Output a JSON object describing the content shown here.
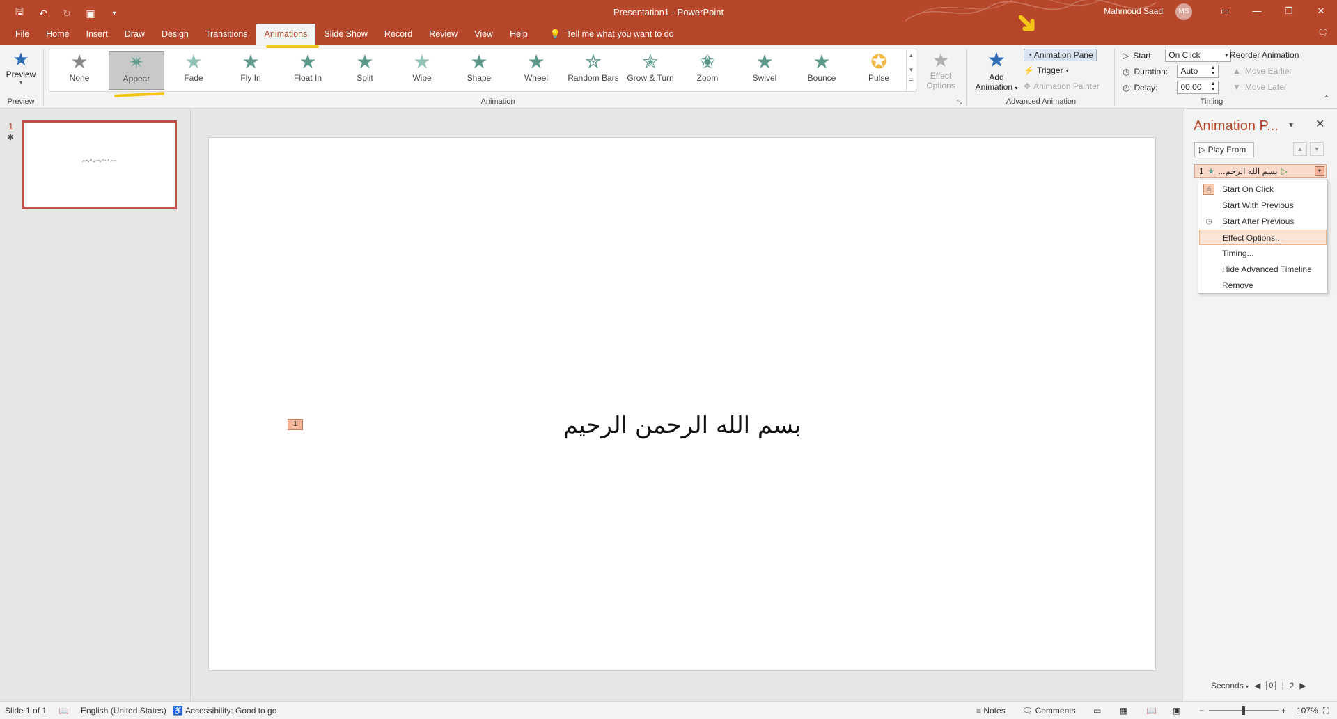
{
  "titlebar": {
    "doc_title": "Presentation1  -  PowerPoint",
    "user_name": "Mahmoud Saad",
    "user_initials": "MS"
  },
  "tabs": [
    "File",
    "Home",
    "Insert",
    "Draw",
    "Design",
    "Transitions",
    "Animations",
    "Slide Show",
    "Record",
    "Review",
    "View",
    "Help"
  ],
  "active_tab": "Animations",
  "tell_me": "Tell me what you want to do",
  "ribbon": {
    "preview": {
      "label": "Preview",
      "group": "Preview"
    },
    "animation_group": "Animation",
    "gallery": [
      "None",
      "Appear",
      "Fade",
      "Fly In",
      "Float In",
      "Split",
      "Wipe",
      "Shape",
      "Wheel",
      "Random Bars",
      "Grow & Turn",
      "Zoom",
      "Swivel",
      "Bounce",
      "Pulse"
    ],
    "selected_animation": "Appear",
    "effect_options": {
      "line1": "Effect",
      "line2": "Options"
    },
    "advanced": {
      "group": "Advanced Animation",
      "add_line1": "Add",
      "add_line2": "Animation",
      "animation_pane": "Animation Pane",
      "trigger": "Trigger",
      "animation_painter": "Animation Painter"
    },
    "timing": {
      "group": "Timing",
      "start_label": "Start:",
      "start_value": "On Click",
      "duration_label": "Duration:",
      "duration_value": "Auto",
      "delay_label": "Delay:",
      "delay_value": "00.00",
      "reorder": "Reorder Animation",
      "move_earlier": "Move Earlier",
      "move_later": "Move Later"
    }
  },
  "thumbnails": {
    "number": "1"
  },
  "slide": {
    "text": "بسم الله الرحمن الرحيم",
    "anim_tag": "1"
  },
  "anim_pane": {
    "title": "Animation P...",
    "play_from": "Play From",
    "item_number": "1",
    "item_label": "بسم الله الرحم...",
    "menu": [
      "Start On Click",
      "Start With Previous",
      "Start After Previous",
      "Effect Options...",
      "Timing...",
      "Hide Advanced Timeline",
      "Remove"
    ],
    "highlighted": "Effect Options...",
    "seconds_label": "Seconds",
    "timeline_start": "0",
    "timeline_end": "2"
  },
  "statusbar": {
    "slide_info": "Slide 1 of 1",
    "language": "English (United States)",
    "accessibility": "Accessibility: Good to go",
    "notes": "Notes",
    "comments": "Comments",
    "zoom": "107%"
  },
  "colors": {
    "brand": "#b7472a",
    "highlight": "#f5c518"
  }
}
